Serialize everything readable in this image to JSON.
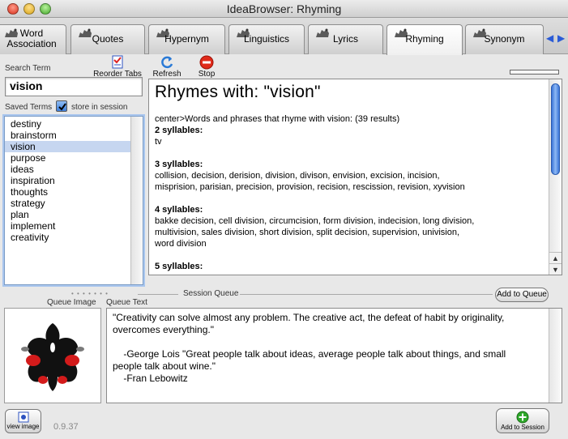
{
  "window": {
    "title": "IdeaBrowser: Rhyming"
  },
  "tabs": [
    {
      "label": "Word\nAssociation",
      "label1": "Word",
      "label2": "Association"
    },
    {
      "label": "Quotes"
    },
    {
      "label": "Hypernym"
    },
    {
      "label": "Linguistics"
    },
    {
      "label": "Lyrics"
    },
    {
      "label": "Rhyming",
      "active": true
    },
    {
      "label": "Synonym"
    }
  ],
  "toolbar": {
    "search_label": "Search Term",
    "search_value": "vision",
    "reorder_tabs": "Reorder Tabs",
    "refresh": "Refresh",
    "stop": "Stop"
  },
  "saved": {
    "label": "Saved Terms",
    "store_label": "store in session",
    "store_checked": true,
    "items": [
      "destiny",
      "brainstorm",
      "vision",
      "purpose",
      "ideas",
      "inspiration",
      "thoughts",
      "strategy",
      "plan",
      "implement",
      "creativity"
    ],
    "selected": "vision"
  },
  "results": {
    "title": "Rhymes with: \"vision\"",
    "summary": "center>Words and phrases that rhyme with vision:    (39  results)",
    "groups": [
      {
        "heading": "2 syllables:",
        "lines": [
          "tv"
        ]
      },
      {
        "heading": "3 syllables:",
        "lines": [
          "collision,  decision,  derision,  division,  divison,  envision,  excision,  incision,",
          "misprision,  parisian,  precision,  provision,  recision,  rescission,  revision,  xyvision"
        ]
      },
      {
        "heading": "4 syllables:",
        "lines": [
          "bakke  decision,  cell  division,  circumcision,  form  division,  indecision,  long  division,",
          "multivision,  sales  division,  short  division,  split  decision,  supervision,  univision,",
          "word  division"
        ]
      },
      {
        "heading": "5 syllables:",
        "lines": []
      }
    ]
  },
  "session": {
    "queue_label": "Session Queue",
    "add_to_queue": "Add to Queue",
    "queue_image_label": "Queue Image",
    "queue_text_label": "Queue Text",
    "queue_text": [
      "\"Creativity can solve almost any problem. The creative act, the defeat of habit by originality,",
      "overcomes everything.\"",
      "",
      "    -George Lois \"Great people talk about ideas, average people talk about things, and small",
      "people talk about wine.\"",
      "    -Fran Lebowitz"
    ]
  },
  "bottom": {
    "view_image": "view image",
    "version": "0.9.37",
    "add_to_session": "Add to Session"
  }
}
